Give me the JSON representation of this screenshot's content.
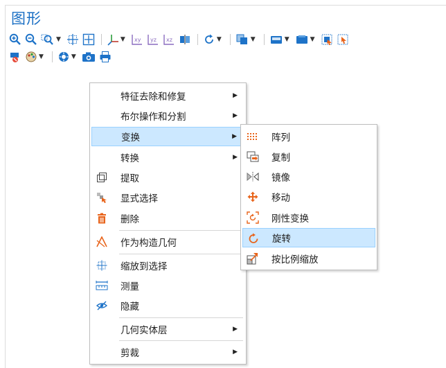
{
  "panel": {
    "title": "图形"
  },
  "toolbar": {
    "row1": [
      "zoom-in-icon",
      "zoom-out-icon",
      "zoom-box-icon",
      "zoom-selection-icon",
      "zoom-extents-icon",
      "axis-orientation-icon",
      "view-xy-icon",
      "view-yz-icon",
      "view-xz-icon",
      "view-split-icon",
      "rotate-view-icon",
      "transparency-icon",
      "selection-mode-icon",
      "select-box-icon",
      "select-all-icon",
      "deselect-icon"
    ],
    "row2": [
      "clear-selection-icon",
      "color-scheme-icon",
      "scene-light-icon",
      "screenshot-icon",
      "print-icon"
    ],
    "view_labels": {
      "xy": "xy",
      "yz": "yz",
      "xz": "xz"
    }
  },
  "context_menu": {
    "items": [
      {
        "label": "特征去除和修复",
        "submenu": true
      },
      {
        "label": "布尔操作和分割",
        "submenu": true
      },
      {
        "label": "变换",
        "submenu": true,
        "highlighted": true
      },
      {
        "label": "转换",
        "submenu": true
      },
      {
        "label": "提取",
        "icon": "extract-icon"
      },
      {
        "label": "显式选择",
        "icon": "explicit-selection-icon"
      },
      {
        "label": "删除",
        "icon": "delete-icon"
      },
      {
        "label": "作为构造几何",
        "icon": "construction-geometry-icon"
      },
      {
        "label": "缩放到选择",
        "icon": "zoom-to-selection-icon"
      },
      {
        "label": "测量",
        "icon": "measure-icon"
      },
      {
        "label": "隐藏",
        "icon": "hide-icon"
      },
      {
        "label": "几何实体层",
        "submenu": true
      },
      {
        "label": "剪裁",
        "submenu": true
      }
    ]
  },
  "transform_submenu": {
    "items": [
      {
        "label": "阵列",
        "icon": "array-icon"
      },
      {
        "label": "复制",
        "icon": "copy-icon"
      },
      {
        "label": "镜像",
        "icon": "mirror-icon"
      },
      {
        "label": "移动",
        "icon": "move-icon"
      },
      {
        "label": "刚性变换",
        "icon": "rigid-transform-icon"
      },
      {
        "label": "旋转",
        "icon": "rotate-icon",
        "highlighted": true
      },
      {
        "label": "按比例缩放",
        "icon": "scale-icon"
      }
    ]
  },
  "colors": {
    "title": "#1a6fc4",
    "highlight_bg": "#cce8ff",
    "highlight_border": "#99d1ff",
    "icon_blue": "#1e73c8",
    "icon_orange": "#e8641b",
    "icon_red": "#c0392b"
  }
}
